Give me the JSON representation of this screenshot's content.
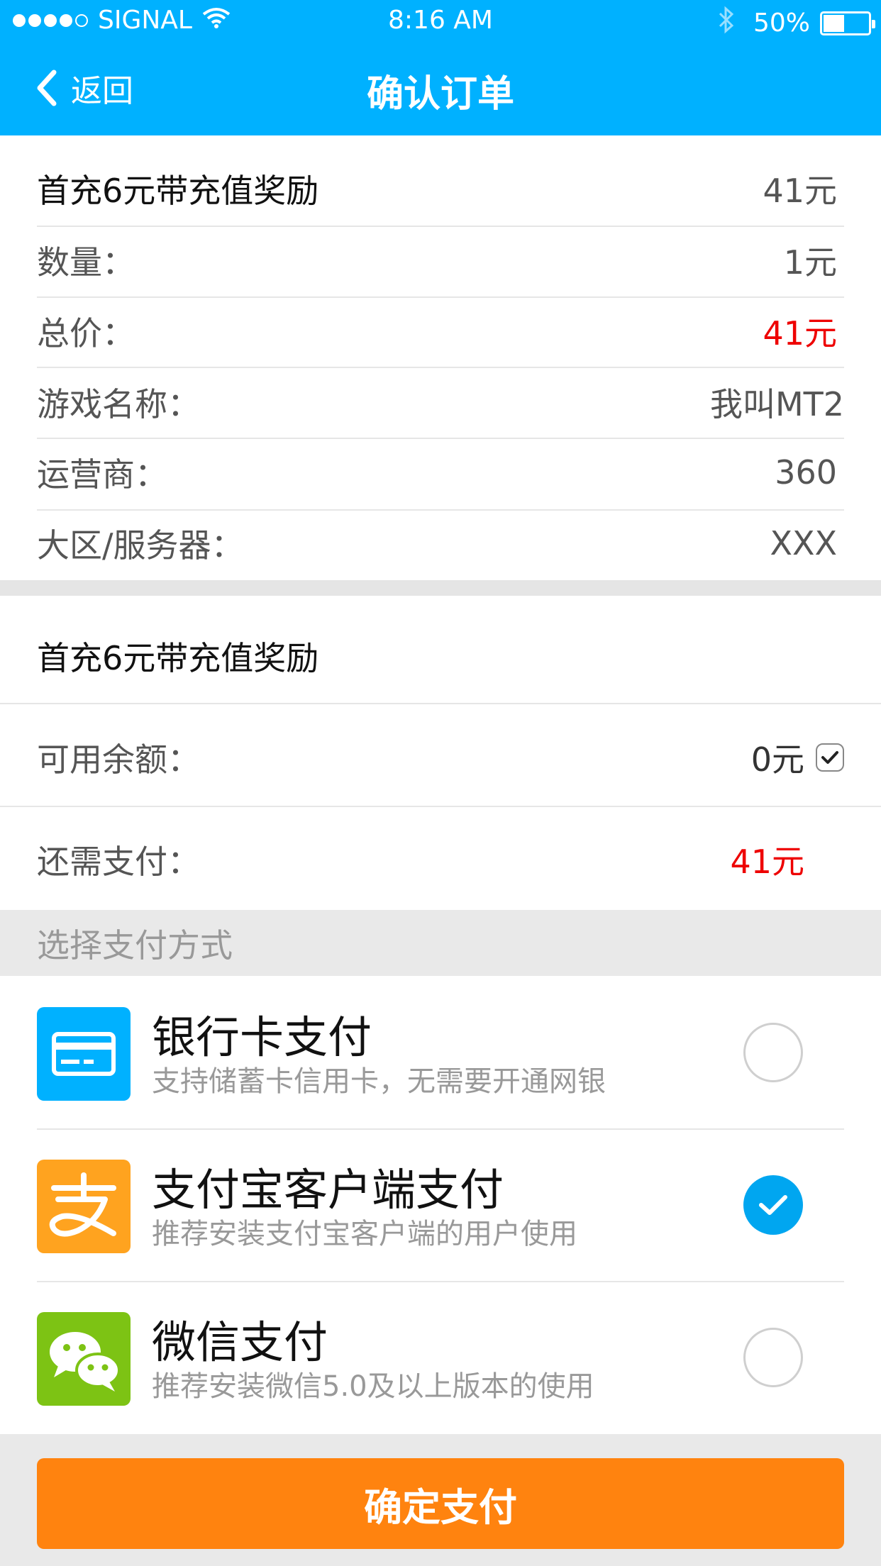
{
  "status_bar": {
    "carrier": "SIGNAL",
    "time": "8:16 AM",
    "battery": "50%",
    "battery_level": 0.5
  },
  "nav": {
    "back_label": "返回",
    "title": "确认订单"
  },
  "order": {
    "product_name": "首充6元带充值奖励",
    "product_price": "41元",
    "rows": [
      {
        "label": "数量：",
        "value": "1元"
      },
      {
        "label": "总价：",
        "value": "41元",
        "color": "#ee0000"
      },
      {
        "label": "游戏名称：",
        "value": "我叫MT2"
      },
      {
        "label": "运营商：",
        "value": "360"
      },
      {
        "label": "大区/服务器：",
        "value": "XXX"
      }
    ]
  },
  "summary": {
    "product_name": "首充6元带充值奖励",
    "balance_label": "可用余额：",
    "balance_value": "0元",
    "balance_checked": true,
    "due_label": "还需支付：",
    "due_value": "41元"
  },
  "payment": {
    "section_title": "选择支付方式",
    "methods": [
      {
        "name": "银行卡支付",
        "desc": "支持储蓄卡信用卡，无需要开通网银",
        "icon": "bank-card-icon",
        "color": "#00b1ff",
        "selected": false
      },
      {
        "name": "支付宝客户端支付",
        "desc": "推荐安装支付宝客户端的用户使用",
        "icon": "alipay-icon",
        "color": "#ffa31f",
        "selected": true
      },
      {
        "name": "微信支付",
        "desc": "推荐安装微信5.0及以上版本的使用",
        "icon": "wechat-icon",
        "color": "#7dc314",
        "selected": false
      }
    ]
  },
  "footer": {
    "confirm_label": "确定支付",
    "confirm_color": "#ff830f"
  },
  "colors": {
    "header": "#00b1ff",
    "accent_red": "#ee0000",
    "radio_on": "#00a6f0"
  }
}
